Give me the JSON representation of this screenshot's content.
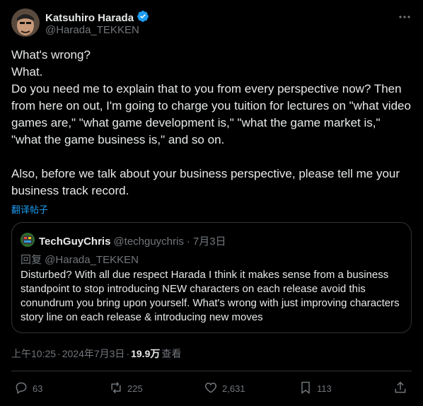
{
  "author": {
    "display_name": "Katsuhiro Harada",
    "handle": "@Harada_TEKKEN"
  },
  "tweet": {
    "lines": [
      "What's wrong?",
      "What.",
      "Do you need me to explain that to you from every perspective now? Then from here on out, I'm going to charge you tuition for lectures on \"what video games are,\" \"what game development is,\" \"what the game market is,\" \"what the game business is,\" and so on.",
      "Also, before we talk about your business perspective, please tell me your business track record."
    ],
    "translate_label": "翻译帖子"
  },
  "quote": {
    "display_name": "TechGuyChris",
    "handle": "@techguychris",
    "separator": "·",
    "date": "7月3日",
    "reply_to": "回复 @Harada_TEKKEN",
    "text": "Disturbed? With all due respect Harada I think it makes sense from a business standpoint to stop introducing NEW characters on each release avoid this conundrum you bring upon yourself. What's wrong with just improving characters story line on each release & introducing new moves"
  },
  "meta": {
    "time": "上午10:25",
    "sep1": "·",
    "date": "2024年7月3日",
    "sep2": "·",
    "views": "19.9万",
    "views_label": "查看"
  },
  "actions": {
    "replies": "63",
    "reposts": "225",
    "likes": "2,631",
    "bookmarks": "113"
  },
  "colors": {
    "background": "#000000",
    "text": "#e7e9ea",
    "muted": "#71767b",
    "accent": "#1d9bf0",
    "border": "#2f3336"
  },
  "icons": [
    "verified-badge-icon",
    "more-icon",
    "reply-icon",
    "repost-icon",
    "like-icon",
    "bookmark-icon",
    "share-icon"
  ]
}
